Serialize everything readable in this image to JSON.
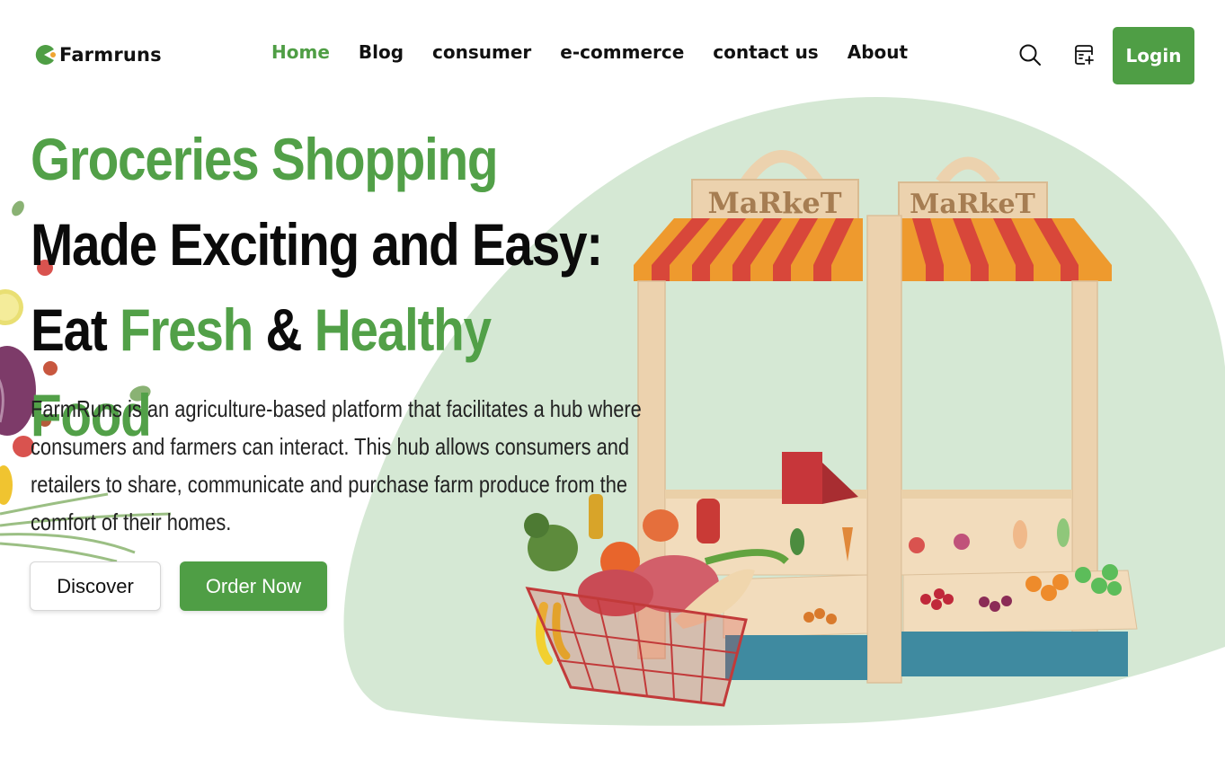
{
  "brand": {
    "name": "Farmruns"
  },
  "nav": {
    "items": [
      {
        "label": "Home",
        "active": true
      },
      {
        "label": "Blog",
        "active": false
      },
      {
        "label": "consumer",
        "active": false
      },
      {
        "label": "e-commerce",
        "active": false
      },
      {
        "label": "contact us",
        "active": false
      },
      {
        "label": "About",
        "active": false
      }
    ],
    "login_label": "Login"
  },
  "icons": {
    "search": "search-icon",
    "shop": "store-icon"
  },
  "hero": {
    "headline_parts": [
      {
        "text": "Groceries Shopping ",
        "color": "green"
      },
      {
        "text": "Made Exciting and Easy: Eat ",
        "color": "black"
      },
      {
        "text": "Fresh",
        "color": "green"
      },
      {
        "text": " & ",
        "color": "black"
      },
      {
        "text": "Healthy Food",
        "color": "green"
      }
    ],
    "description": "FarmRuns is an agriculture-based platform that facilitates a hub where consumers and farmers can interact. This hub allows consumers and retailers to share, communicate and purchase farm produce from the comfort of their homes.",
    "discover_label": "Discover",
    "order_label": "Order Now"
  },
  "illustration": {
    "market_sign_text": "MaRkeT"
  },
  "colors": {
    "brand_green": "#4f9e45",
    "blob_green": "#d5e8d4",
    "text_dark": "#0b0b0b"
  }
}
